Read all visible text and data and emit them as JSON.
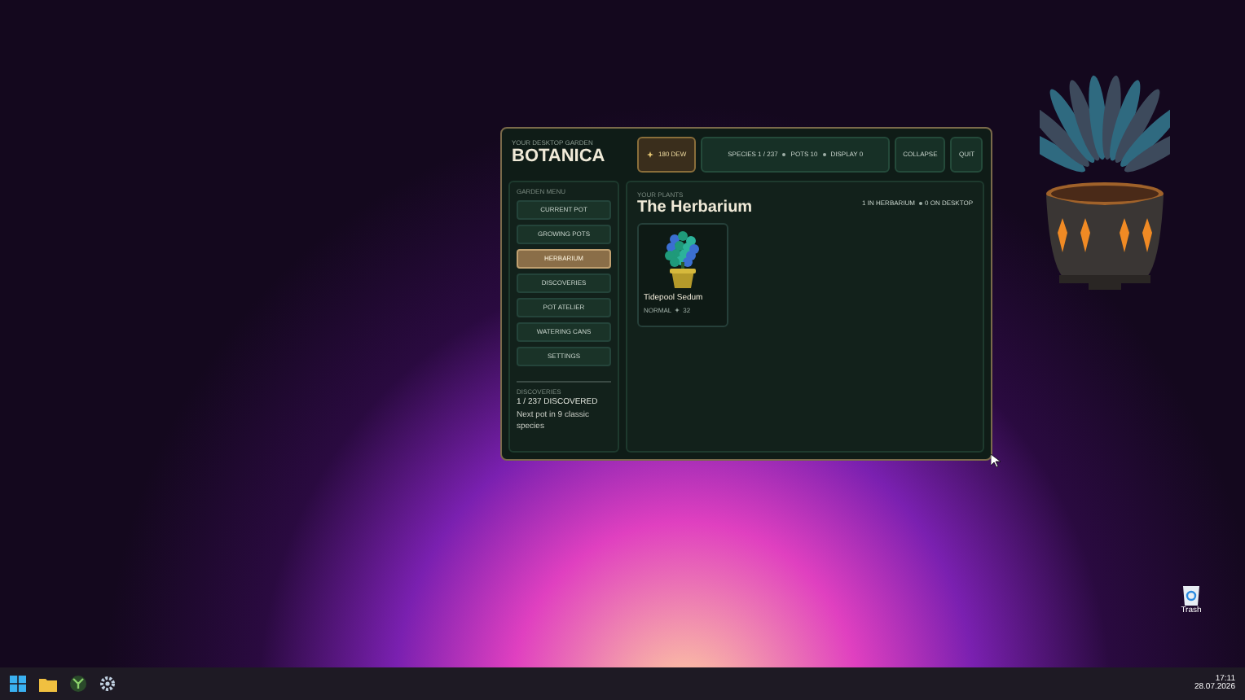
{
  "window": {
    "subtitle": "YOUR DESKTOP GARDEN",
    "title": "BOTANICA"
  },
  "dew": {
    "label": "180 DEW"
  },
  "stats": [
    "SPECIES 1 / 237",
    "POTS 10",
    "DISPLAY 0"
  ],
  "header_buttons": [
    "COLLAPSE",
    "QUIT"
  ],
  "menu": {
    "heading": "GARDEN MENU",
    "items": [
      {
        "label": "CURRENT POT",
        "selected": false
      },
      {
        "label": "GROWING POTS",
        "selected": false
      },
      {
        "label": "HERBARIUM",
        "selected": true
      },
      {
        "label": "DISCOVERIES",
        "selected": false
      },
      {
        "label": "POT ATELIER",
        "selected": false
      },
      {
        "label": "WATERING CANS",
        "selected": false
      },
      {
        "label": "SETTINGS",
        "selected": false
      }
    ]
  },
  "discoveries": {
    "heading": "DISCOVERIES",
    "count": "1 / 237 DISCOVERED",
    "note": "Next pot in 9 classic species"
  },
  "herbarium": {
    "eyebrow": "YOUR PLANTS",
    "title": "The Herbarium",
    "counts": [
      "1 IN HERBARIUM",
      "0 ON DESKTOP"
    ],
    "cards": [
      {
        "name": "Tidepool Sedum",
        "rarity": "NORMAL",
        "score": "32"
      }
    ]
  },
  "desktop_icons": [
    {
      "label": "Trash"
    }
  ],
  "clock": {
    "time": "17:11",
    "date": "28.07.2026"
  }
}
